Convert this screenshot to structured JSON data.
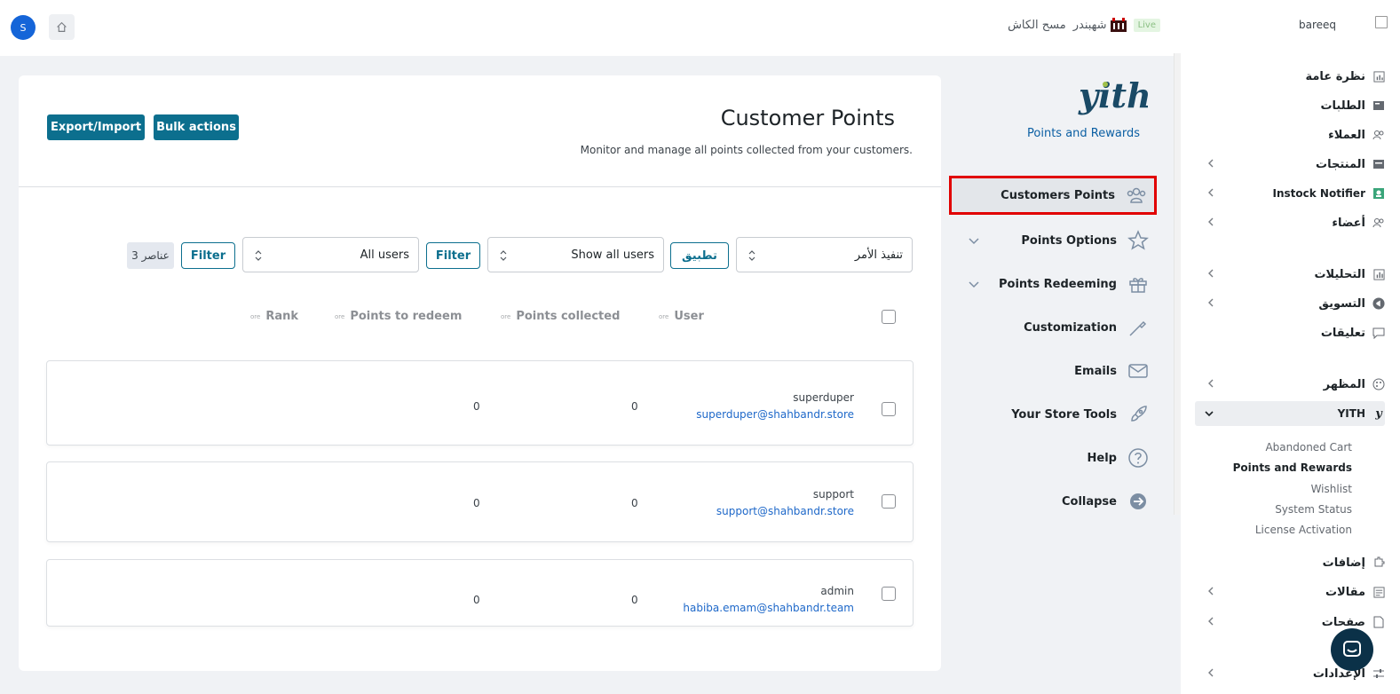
{
  "topbar": {
    "avatar_letter": "S",
    "cache_label": "مسح الكاش",
    "store_brand": "شهبندر",
    "live_badge": "Live",
    "site_name": "bareeq"
  },
  "admin_menu": {
    "items": [
      {
        "label": "نظرة عامة",
        "icon": "dashboard-icon"
      },
      {
        "label": "الطلبات",
        "icon": "orders-icon"
      },
      {
        "label": "العملاء",
        "icon": "customers-icon"
      },
      {
        "label": "المنتجات",
        "icon": "products-icon"
      },
      {
        "label": "Instock Notifier",
        "icon": "notifier-icon"
      },
      {
        "label": "أعضاء",
        "icon": "members-icon"
      },
      {
        "label": "التحليلات",
        "icon": "analytics-icon"
      },
      {
        "label": "التسويق",
        "icon": "marketing-icon"
      },
      {
        "label": "تعليقات",
        "icon": "comments-icon"
      },
      {
        "label": "المظهر",
        "icon": "appearance-icon"
      },
      {
        "label": "YITH",
        "icon": "yith-icon"
      },
      {
        "label": "إضافات",
        "icon": "plugins-icon"
      },
      {
        "label": "مقالات",
        "icon": "posts-icon"
      },
      {
        "label": "صفحات",
        "icon": "pages-icon"
      },
      {
        "label": "الإعدادات",
        "icon": "settings-icon"
      }
    ],
    "yith_submenu": [
      "Abandoned Cart",
      "Points and Rewards",
      "Wishlist",
      "System Status",
      "License Activation"
    ],
    "current_submenu": "Points and Rewards"
  },
  "plugin_nav": {
    "title": "Points and Rewards",
    "logo_text": "yith",
    "items": [
      {
        "label": "Customers Points",
        "icon": "customers-points-icon"
      },
      {
        "label": "Points Options",
        "icon": "star-icon"
      },
      {
        "label": "Points Redeeming",
        "icon": "gift-icon"
      },
      {
        "label": "Customization",
        "icon": "pipette-icon"
      },
      {
        "label": "Emails",
        "icon": "envelope-icon"
      },
      {
        "label": "Your Store Tools",
        "icon": "rocket-icon"
      },
      {
        "label": "Help",
        "icon": "help-icon"
      },
      {
        "label": "Collapse",
        "icon": "collapse-icon"
      }
    ]
  },
  "page": {
    "title": "Customer Points",
    "subtitle": "Monitor and manage all points collected from your customers.",
    "bulk_actions_label": "Bulk actions",
    "export_import_label": "Export/Import"
  },
  "filters": {
    "bulk_action_select": "تنفيذ الأمر",
    "apply_label": "تطبيق",
    "show_users_select": "Show all users",
    "filter_label": "Filter",
    "users_select": "All users",
    "filter2_label": "Filter",
    "count_label": "3 عناصر"
  },
  "table": {
    "columns": [
      "User",
      "Points collected",
      "Points to redeem",
      "Rank"
    ],
    "sort_indicator": "ore",
    "rows": [
      {
        "name": "superduper",
        "email": "superduper@shahbandr.store",
        "points_collected": "0",
        "points_to_redeem": "0"
      },
      {
        "name": "support",
        "email": "support@shahbandr.store",
        "points_collected": "0",
        "points_to_redeem": "0"
      },
      {
        "name": "admin",
        "email": "habiba.emam@shahbandr.team",
        "points_collected": "0",
        "points_to_redeem": "0"
      }
    ]
  },
  "colors": {
    "primary": "#0c6f8e",
    "link": "#1e68c9",
    "highlight_border": "#e10000",
    "plugin_title": "#0b5fa3"
  }
}
